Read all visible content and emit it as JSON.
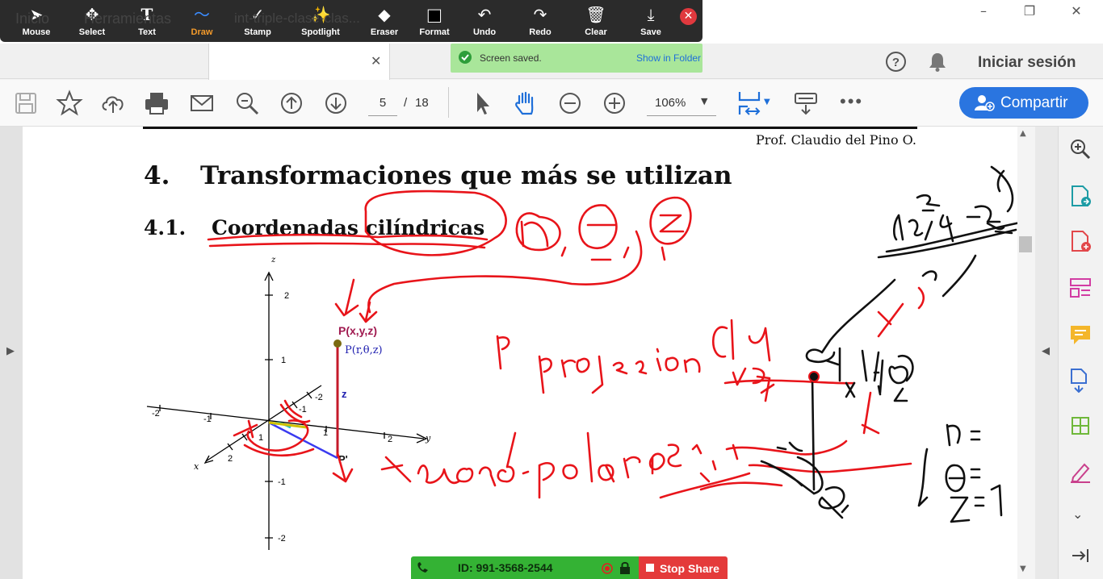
{
  "annotate_toolbar": {
    "tools": [
      {
        "label": "Mouse",
        "icon": "mouse-pointer-icon",
        "glyph": "➤"
      },
      {
        "label": "Select",
        "icon": "select-move-icon",
        "glyph": "✥"
      },
      {
        "label": "Text",
        "icon": "text-icon",
        "glyph": "T"
      },
      {
        "label": "Draw",
        "icon": "draw-squiggle-icon",
        "glyph": "〜"
      },
      {
        "label": "Stamp",
        "icon": "stamp-check-icon",
        "glyph": "✓"
      },
      {
        "label": "Spotlight",
        "icon": "spotlight-wand-icon",
        "glyph": "✨"
      },
      {
        "label": "Eraser",
        "icon": "eraser-icon",
        "glyph": "◆"
      },
      {
        "label": "Format",
        "icon": "format-swatch-icon",
        "glyph": "■"
      },
      {
        "label": "Undo",
        "icon": "undo-icon",
        "glyph": "↶"
      },
      {
        "label": "Redo",
        "icon": "redo-icon",
        "glyph": "↷"
      },
      {
        "label": "Clear",
        "icon": "trash-icon",
        "glyph": "🗑"
      },
      {
        "label": "Save",
        "icon": "save-download-icon",
        "glyph": "⤓"
      }
    ],
    "active_tool": "Draw",
    "active_color": "#3b8cff"
  },
  "tabs": {
    "home": "Inicio",
    "tools": "Herramientas",
    "document": "int-triple-clase-clas..."
  },
  "toast": {
    "message": "Screen saved.",
    "link": "Show in Folder"
  },
  "header": {
    "signin": "Iniciar sesión"
  },
  "reader_toolbar": {
    "page_current": "5",
    "page_sep": "/",
    "page_total": "18",
    "zoom": "106%",
    "share_label": "Compartir"
  },
  "document": {
    "author": "Prof. Claudio del Pino O.",
    "section_number": "4.",
    "section_title": "Transformaciones que más se utilizan",
    "subsection_number": "4.1.",
    "subsection_title": "Coordenadas cilíndricas",
    "figure": {
      "axis_z": "z",
      "axis_y": "y",
      "axis_x": "x",
      "z_ticks": [
        "2",
        "1",
        "-1",
        "-2"
      ],
      "y_ticks": [
        "-2",
        "-1",
        "1",
        "2"
      ],
      "x_ticks": [
        "-2",
        "-1",
        "1",
        "2"
      ],
      "point_label_cart": "P(x,y,z)",
      "point_label_cyl": "P(r,θ,z)",
      "height_label": "z",
      "proj_label": "P'"
    }
  },
  "share_bar": {
    "meeting_id": "ID: 991-3568-2544",
    "stop_label": "Stop Share"
  },
  "colors": {
    "ink_red": "#e8141a",
    "ink_black": "#111111",
    "share_green": "#34b234",
    "stop_red": "#e43a3a",
    "accent_blue": "#2a75e0"
  }
}
